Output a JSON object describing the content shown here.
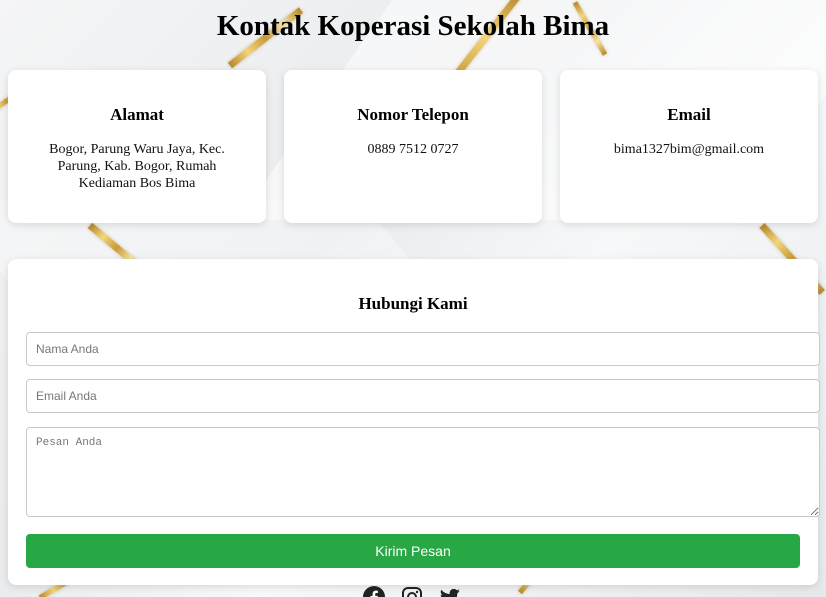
{
  "page": {
    "title": "Kontak Koperasi Sekolah Bima"
  },
  "cards": [
    {
      "heading": "Alamat",
      "text": "Bogor, Parung Waru Jaya, Kec. Parung, Kab. Bogor, Rumah Kediaman Bos Bima"
    },
    {
      "heading": "Nomor Telepon",
      "text": "0889 7512 0727"
    },
    {
      "heading": "Email",
      "text": "bima1327bim@gmail.com"
    }
  ],
  "form": {
    "heading": "Hubungi Kami",
    "name_placeholder": "Nama Anda",
    "email_placeholder": "Email Anda",
    "message_placeholder": "Pesan Anda",
    "submit_label": "Kirim Pesan"
  },
  "social": {
    "icons": [
      "facebook-icon",
      "instagram-icon",
      "twitter-icon"
    ]
  },
  "colors": {
    "accent": "#28a745",
    "gold": "#d4af37"
  }
}
